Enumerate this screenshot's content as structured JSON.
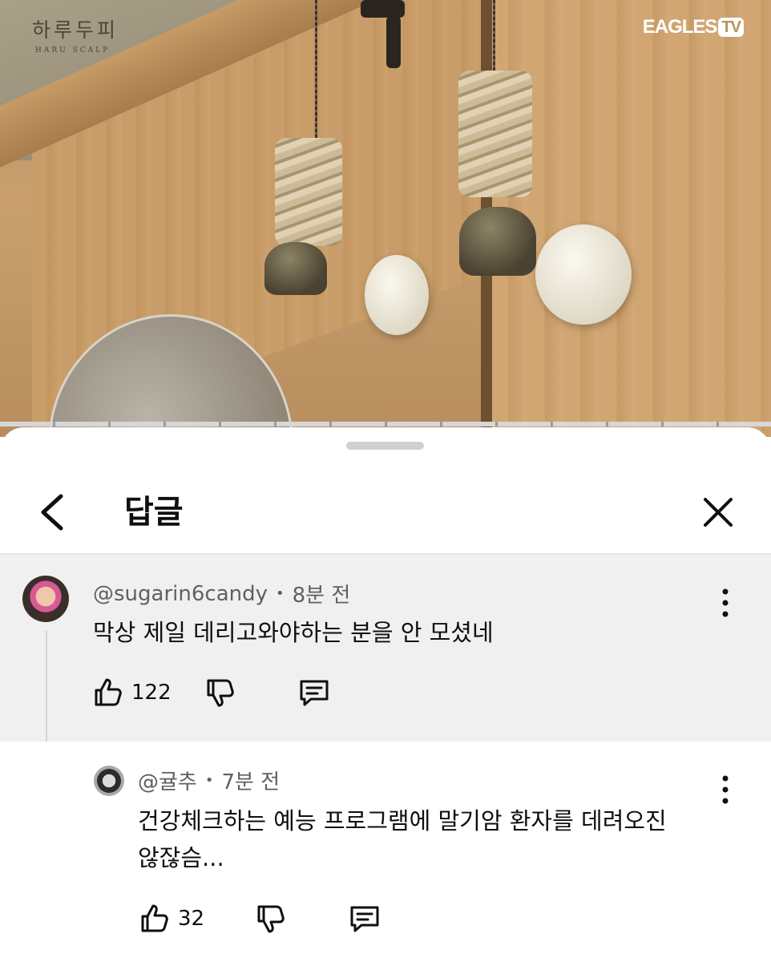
{
  "video": {
    "brand_left_ko": "하루두피",
    "brand_left_en": "HARU SCALP",
    "brand_right": "EAGLES",
    "brand_right_badge": "TV"
  },
  "sheet": {
    "title": "답글"
  },
  "comments": [
    {
      "author": "@sugarin6candy",
      "time": "8분 전",
      "text": "막상 제일 데리고와야하는 분을 안 모셨네",
      "likes": "122"
    },
    {
      "author": "@귤추",
      "time": "7분 전",
      "text_line1": "건강체크하는 예능 프로그램에 말기암 환자를 데려오진",
      "text_line2": "않잖슴...",
      "likes": "32"
    }
  ],
  "icons": {
    "back": "chevron-left-icon",
    "close": "close-icon",
    "like": "thumbs-up-icon",
    "dislike": "thumbs-down-icon",
    "reply": "reply-bubble-icon",
    "more": "more-vertical-icon"
  },
  "colors": {
    "sheet_background": "#ffffff",
    "highlighted_comment_background": "#f0f0f0",
    "secondary_text": "#606060",
    "primary_text": "#0f0f0f"
  }
}
